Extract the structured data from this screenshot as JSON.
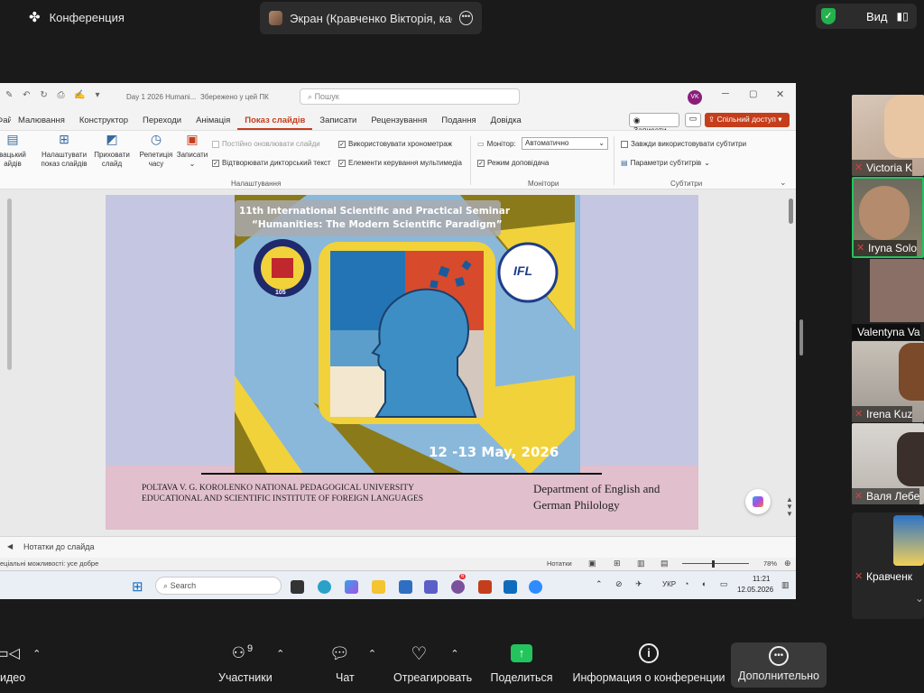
{
  "zoom_top": {
    "meeting_label": "Конференция",
    "share_label": "Экран (Кравченко Вікторія, кафе",
    "view_label": "Вид"
  },
  "powerpoint": {
    "doc_title": "Day 1 2026 Humani...",
    "save_status": "Збережено у цей ПК",
    "search_placeholder": "Пошук",
    "user_initials": "VK",
    "tabs": [
      "Файл",
      "Малювання",
      "Конструктор",
      "Переходи",
      "Анімація",
      "Показ слайдів",
      "Записати",
      "Рецензування",
      "Подання",
      "Довідка"
    ],
    "active_tab": "Показ слайдів",
    "record_btn": "Записати",
    "share_btn": "Спільний доступ",
    "ribbon": {
      "custom_show": [
        "вацький",
        "айдів"
      ],
      "setup_show": [
        "Налаштувати",
        "показ слайдів"
      ],
      "hide_slide": [
        "Приховати",
        "слайд"
      ],
      "rehearse": [
        "Репетиція",
        "часу"
      ],
      "record": "Записати",
      "chk_keep_updated": "Постійно оновлювати слайди",
      "chk_narration": "Відтворювати дикторський текст",
      "chk_timings": "Використовувати хронометраж",
      "chk_media_controls": "Елементи керування мультимедіа",
      "monitor_label": "Монітор:",
      "monitor_value": "Автоматично",
      "presenter_view": "Режим доповідача",
      "chk_subtitles": "Завжди використовувати субтитри",
      "subtitle_settings": "Параметри субтитрів",
      "group_setup": "Налаштування",
      "group_monitors": "Монітори",
      "group_captions": "Субтитри"
    },
    "slide": {
      "seminar_line1": "11th International Scientific and Practical Seminar",
      "seminar_line2": "“Humanities: The Modern Scientific  Paradigm”",
      "dates": "12 -13 May, 2026",
      "university_line1": "POLTAVA V. G. KOROLENKO NATIONAL PEDAGOGICAL UNIVERSITY",
      "university_line2": "EDUCATIONAL AND SCIENTIFIC INSTITUTE OF FOREIGN LANGUAGES",
      "department_line1": "Department of English and",
      "department_line2": "German Philology",
      "logo_left_text": "105",
      "logo_right_text": "IFL"
    },
    "notes_placeholder": "Нотатки до слайда",
    "status_text": "еціальні можливості: усе добре",
    "notes_btn": "Нотатки",
    "zoom_percent": "78%",
    "taskbar": {
      "search": "Search",
      "lang": "УКР",
      "time": "11:21",
      "date": "12.05.2026",
      "badge": "6"
    }
  },
  "participants": [
    {
      "name": "Victoria K",
      "muted": true
    },
    {
      "name": "Iryna Solo",
      "muted": true
    },
    {
      "name": "Valentyna Va",
      "muted": false
    },
    {
      "name": "Irena Kuz",
      "muted": true
    },
    {
      "name": "Валя Лебе",
      "muted": true
    },
    {
      "name": "Кравченк",
      "muted": true
    }
  ],
  "zoom_bottom": {
    "video": "идео",
    "participants": "Участники",
    "participants_count": "9",
    "chat": "Чат",
    "react": "Отреагировать",
    "share": "Поделиться",
    "info": "Информация о конференции",
    "more": "Дополнительно"
  }
}
